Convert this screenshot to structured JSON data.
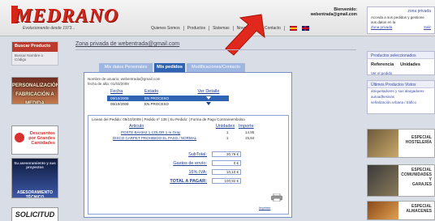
{
  "header": {
    "logo_text": "MEDRANO",
    "logo_tagline": "Evolucionando desde 1973...",
    "nav": [
      "Quienes Somos",
      "Productos",
      "Sistemas",
      "Novedades",
      "Contacto"
    ],
    "welcome_line1": "Bienvenido:",
    "welcome_line2": "webentrada@gmail.com",
    "private_title": "zona privada",
    "private_text": "Acceda a sus pedidos y gestione sus datos en la",
    "private_link": "Zona privada",
    "private_link2": "Salir"
  },
  "left": {
    "search_title": "Buscar Producto",
    "search_sub": "Buscar Nombre o Código",
    "banner1": "PERSONALIZACIÓN\nFABRICACIÓN A MEDIDA",
    "banner2": "Descuentos\npor Grandes\nCantidades",
    "banner3_top": "Su asesoramiento y sus proyectos",
    "banner3_bottom": "ASESORAMIENTO TÉCNICO",
    "banner4": "SOLICITUD"
  },
  "main": {
    "zone_title": "Zona privada de webentrada@gmail.com",
    "tabs": [
      {
        "label": "Mis datos Personales"
      },
      {
        "label": "Mis pedidos"
      },
      {
        "label": "Modificaciones/Contacto"
      }
    ],
    "info_line1": "Nombre de usuario: webentrada@gmail.com",
    "info_line2": "fecha de alta: 01/03/2009",
    "orders_headers": [
      "Fecha",
      "Estado",
      "Ver Detalle"
    ],
    "orders": [
      {
        "fecha": "09/10/2009",
        "estado": "EN PROCESO"
      },
      {
        "fecha": "08/10/2009",
        "estado": "EN PROCESO"
      }
    ],
    "detail_head": "Lineas del Pedido: 09/10/2009 | Pedido nº 138 | Su Pedido: | Forma de Pago Contrareembolso",
    "detail_headers": [
      "Articulo",
      "Unidades",
      "Importe"
    ],
    "detail_rows": [
      {
        "articulo": "POSTE BAHIA2 1 COLOR 1 m Gray",
        "unidades": "1",
        "importe": "14,95"
      },
      {
        "articulo": "DISCO CARPET PROHIBIDO EL PASO / NORMAL",
        "unidades": "1",
        "importe": "15,84"
      }
    ],
    "totals": [
      {
        "label": "SubTotal:",
        "value": "30,79 €"
      },
      {
        "label": "Gastos de envío:",
        "value": "0 €"
      },
      {
        "label": "16% IVA:",
        "value": "10,10 €"
      },
      {
        "label": "TOTAL A PAGAR:",
        "value": "100,92 €"
      }
    ],
    "print_label": "Imprimir"
  },
  "right": {
    "box1_title": "Productos seleccionados",
    "box1_cols": [
      "Referencia",
      "Unidades"
    ],
    "box1_small": "Ver el pedido",
    "box2_title": "Últimos Productos Vistos",
    "box2_items": [
      "atriquetadores y sus alargadores",
      "autoadhesivas",
      "señalización urbana / tráfico"
    ],
    "promo1": "ESPECIAL\nHOSTELERÍA",
    "promo2": "ESPECIAL\nCOMUNIDADES\nY\nGARAJES",
    "promo3": "ESPECIAL\nALMACENES"
  },
  "colors": {
    "brand_red": "#d52418",
    "tab_active": "#2f64b5",
    "tab_inactive": "#9eb6e0",
    "link_blue": "#23408f"
  }
}
